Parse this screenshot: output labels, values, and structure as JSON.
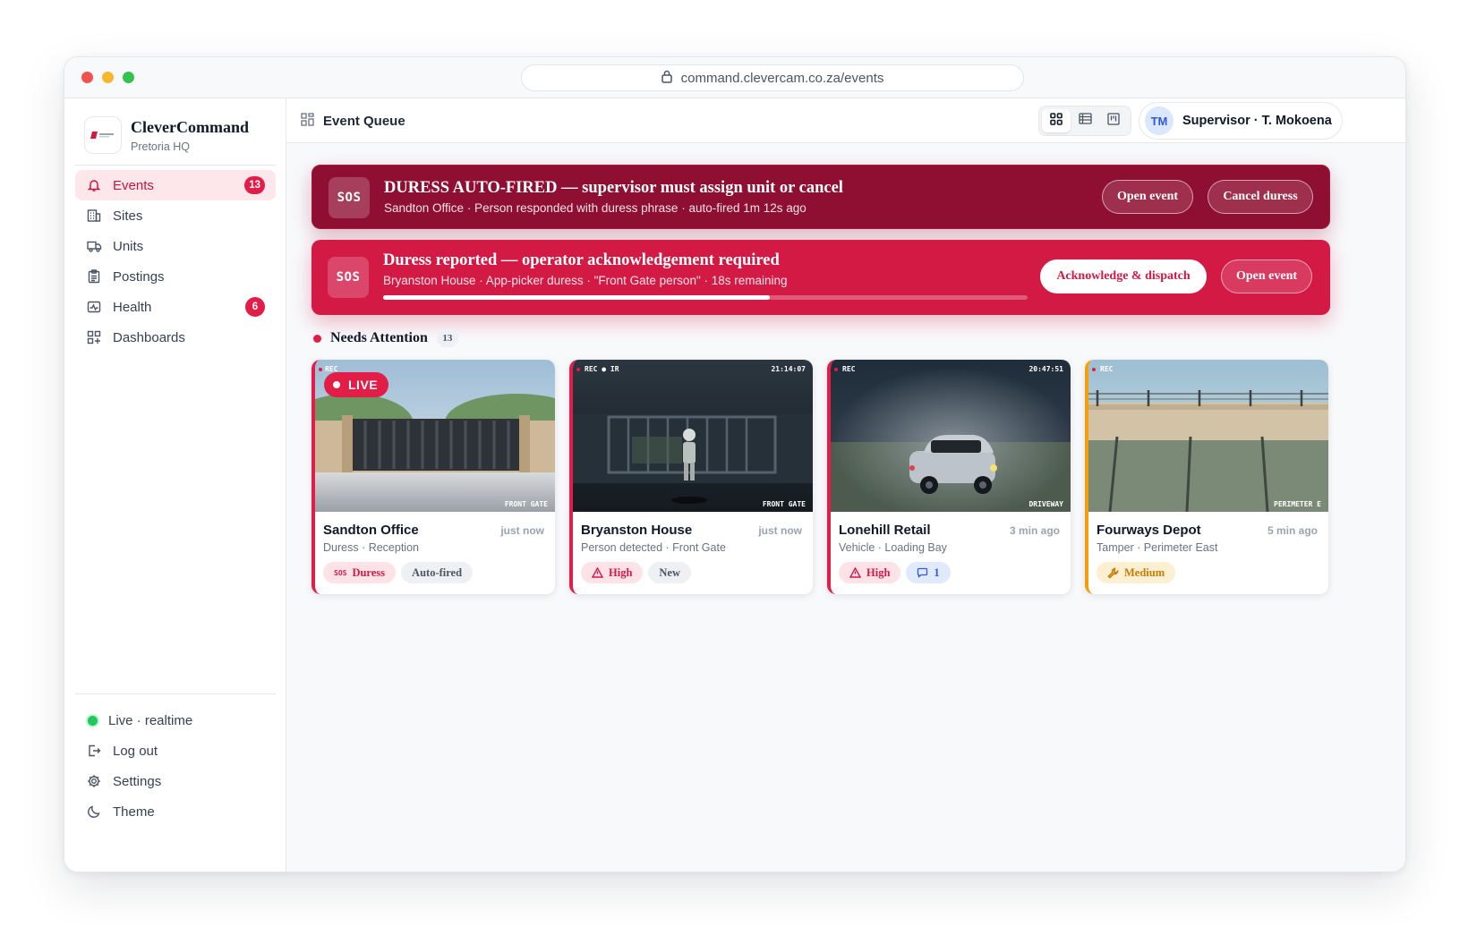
{
  "browser": {
    "url": "command.clevercam.co.za/events"
  },
  "brand": {
    "name": "CleverCommand",
    "subtitle": "Pretoria HQ"
  },
  "nav": [
    {
      "label": "Events",
      "icon": "bell-icon",
      "badge": "13",
      "active": true
    },
    {
      "label": "Sites",
      "icon": "building-icon"
    },
    {
      "label": "Units",
      "icon": "truck-icon"
    },
    {
      "label": "Postings",
      "icon": "clipboard-icon"
    },
    {
      "label": "Health",
      "icon": "pulse-icon",
      "badge": "6"
    },
    {
      "label": "Dashboards",
      "icon": "dashboard-icon"
    }
  ],
  "sidebar_bottom": {
    "status": "Live · realtime",
    "logout": "Log out",
    "settings": "Settings",
    "theme": "Theme"
  },
  "topbar": {
    "title": "Event Queue",
    "user_initials": "TM",
    "user_name": "Supervisor · T. Mokoena"
  },
  "alerts": [
    {
      "badge": "SOS",
      "title": "DURESS AUTO-FIRED — supervisor must assign unit or cancel",
      "subtitle": "Sandton Office · Person responded with duress phrase · auto-fired 1m 12s ago",
      "actions": [
        "Open event",
        "Cancel duress"
      ]
    },
    {
      "badge": "SOS",
      "title": "Duress reported — operator acknowledgement required",
      "subtitle": "Bryanston House · App-picker duress · \"Front Gate person\" · 18s remaining",
      "progress": 0.6,
      "actions": [
        "Acknowledge & dispatch",
        "Open event"
      ]
    }
  ],
  "section": {
    "title": "Needs Attention",
    "count": "13"
  },
  "cards": [
    {
      "title": "Sandton Office",
      "time": "just now",
      "subtitle": "Duress · Reception",
      "live": "LIVE",
      "osd_top": "REC",
      "osd_cam": "FRONT GATE",
      "chips": [
        {
          "label": "Duress",
          "icon": "SOS"
        },
        {
          "label": "Auto-fired"
        }
      ]
    },
    {
      "title": "Bryanston House",
      "time": "just now",
      "subtitle": "Person detected · Front Gate",
      "osd_top": "REC ● IR",
      "osd_clock": "21:14:07",
      "osd_cam": "FRONT GATE",
      "chips": [
        {
          "label": "High"
        },
        {
          "label": "New"
        }
      ]
    },
    {
      "title": "Lonehill Retail",
      "time": "3 min ago",
      "subtitle": "Vehicle · Loading Bay",
      "osd_top": "REC",
      "osd_clock": "20:47:51",
      "osd_cam": "DRIVEWAY",
      "chips": [
        {
          "label": "High"
        },
        {
          "label": "1"
        }
      ]
    },
    {
      "title": "Fourways Depot",
      "time": "5 min ago",
      "subtitle": "Tamper · Perimeter East",
      "osd_top": "REC",
      "osd_cam": "PERIMETER E",
      "chips": [
        {
          "label": "Medium"
        }
      ]
    }
  ],
  "colors": {
    "accent": "#e11d48",
    "duress_dark": "#8f0f32",
    "duress_bright": "#d31a45",
    "amber": "#f59e0b",
    "live": "#22c55e"
  }
}
